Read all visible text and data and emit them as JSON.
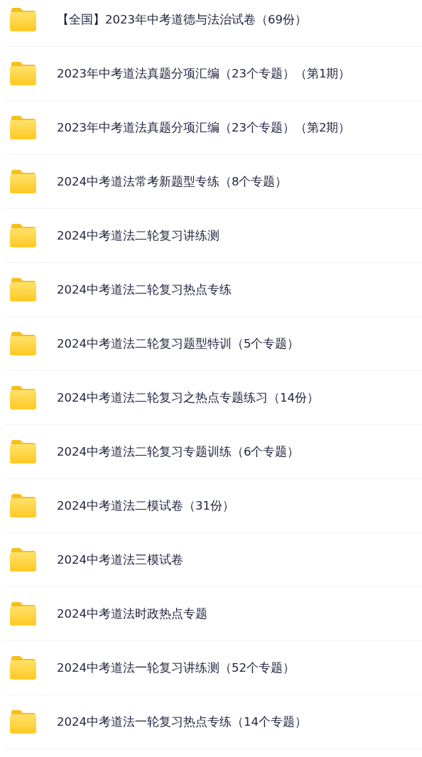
{
  "folders": [
    {
      "name": "【全国】2023年中考道德与法治试卷（69份）"
    },
    {
      "name": "2023年中考道法真题分项汇编（23个专题）（第1期）"
    },
    {
      "name": "2023年中考道法真题分项汇编（23个专题）（第2期）"
    },
    {
      "name": "2024中考道法常考新题型专练（8个专题）"
    },
    {
      "name": "2024中考道法二轮复习讲练测"
    },
    {
      "name": "2024中考道法二轮复习热点专练"
    },
    {
      "name": "2024中考道法二轮复习题型特训（5个专题）"
    },
    {
      "name": "2024中考道法二轮复习之热点专题练习（14份）"
    },
    {
      "name": "2024中考道法二轮复习专题训练（6个专题）"
    },
    {
      "name": "2024中考道法二模试卷（31份）"
    },
    {
      "name": "2024中考道法三模试卷"
    },
    {
      "name": "2024中考道法时政热点专题"
    },
    {
      "name": "2024中考道法一轮复习讲练测（52个专题）"
    },
    {
      "name": "2024中考道法一轮复习热点专练（14个专题）"
    }
  ]
}
